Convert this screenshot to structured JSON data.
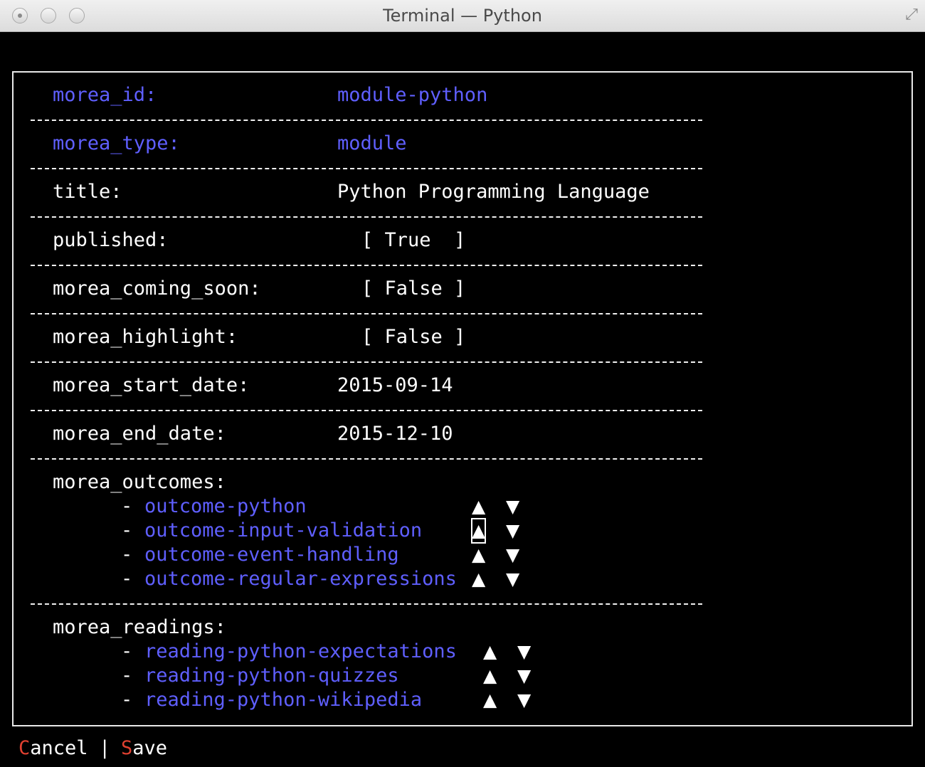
{
  "window": {
    "title": "Terminal — Python"
  },
  "fields": [
    {
      "key": "morea_id:",
      "value": "module-python",
      "highlight": true
    },
    {
      "key": "morea_type:",
      "value": "module",
      "highlight": true
    },
    {
      "key": "title:",
      "value": "Python Programming Language",
      "highlight": false
    },
    {
      "key": "published:",
      "value": "[ True  ]",
      "highlight": false
    },
    {
      "key": "morea_coming_soon:",
      "value": "[ False ]",
      "highlight": false
    },
    {
      "key": "morea_highlight:",
      "value": "[ False ]",
      "highlight": false
    },
    {
      "key": "morea_start_date:",
      "value": "2015-09-14",
      "highlight": false
    },
    {
      "key": "morea_end_date:",
      "value": "2015-12-10",
      "highlight": false
    }
  ],
  "outcomes": {
    "label": "morea_outcomes:",
    "items": [
      "outcome-python",
      "outcome-input-validation",
      "outcome-event-handling",
      "outcome-regular-expressions"
    ]
  },
  "readings": {
    "label": "morea_readings:",
    "items": [
      "reading-python-expectations",
      "reading-python-quizzes",
      "reading-python-wikipedia"
    ]
  },
  "bullet": "-",
  "arrows": {
    "up": "▲",
    "down": "▼"
  },
  "footer": {
    "cancel_hot": "C",
    "cancel_rest": "ancel",
    "separator": "|",
    "save_hot": "S",
    "save_rest": "ave"
  },
  "colors": {
    "accent": "#5f5fff",
    "hotkey": "#e04030",
    "background": "#000000",
    "text": "#ffffff"
  }
}
